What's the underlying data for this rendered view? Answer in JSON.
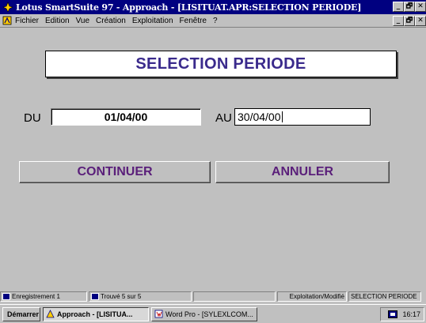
{
  "window": {
    "title": "Lotus SmartSuite 97  - Approach - [LISITUAT.APR:SELECTION PERIODE]",
    "minimize": "_",
    "maximize": "🗗",
    "close": "✕"
  },
  "menu": {
    "items": [
      "Fichier",
      "Edition",
      "Vue",
      "Création",
      "Exploitation",
      "Fenêtre",
      "?"
    ]
  },
  "form": {
    "heading": "SELECTION PERIODE",
    "from_label": "DU",
    "from_value": "01/04/00",
    "to_label": "AU",
    "to_value": "30/04/00",
    "continue_label": "CONTINUER",
    "cancel_label": "ANNULER",
    "heading_color": "#3a2a8c",
    "button_text_color": "#5a1f7a"
  },
  "statusbar": {
    "record": "Enregistrement 1",
    "found": "Trouvé 5 sur 5",
    "mode": "Exploitation/Modifié",
    "view": "SELECTION PERIODE"
  },
  "taskbar": {
    "start": "Démarrer",
    "tasks": [
      "Approach - [LISITUA...",
      "Word Pro - [SYLEXLCOM..."
    ],
    "clock": "16:17"
  }
}
